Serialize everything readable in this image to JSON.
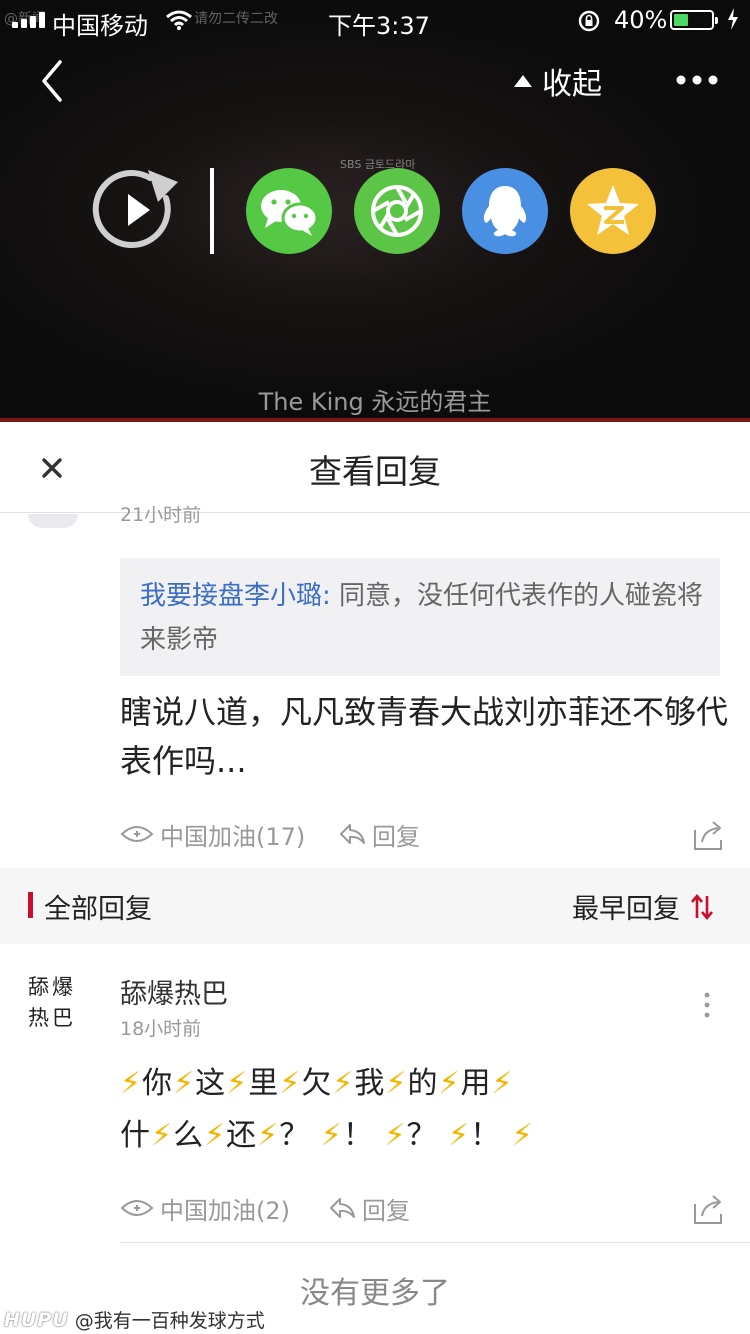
{
  "status_bar": {
    "carrier": "中国移动",
    "time": "下午3:37",
    "battery_percent": "40%",
    "battery_level": 0.4,
    "watermark_left": "@新闻",
    "watermark_right": "请勿二传二改"
  },
  "video": {
    "collapse_label": "收起",
    "subtitle": "The King 永远的君主",
    "logo_text": "SBS 금토드라마",
    "share_targets": [
      "wechat-icon",
      "moments-icon",
      "qq-icon",
      "qzone-icon"
    ]
  },
  "sheet": {
    "title": "查看回复"
  },
  "parent_comment": {
    "time": "21小时前",
    "quote_user": "我要接盘李小璐:",
    "quote_text": " 同意，没任何代表作的人碰瓷将来影帝",
    "text": "瞎说八道，凡凡致青春大战刘亦菲还不够代表作吗...",
    "like_label": "中国加油(17)",
    "reply_label": "回复"
  },
  "section": {
    "title": "全部回复",
    "sort_label": "最早回复"
  },
  "reply": {
    "avatar_text": "舔爆热巴",
    "user_name": "舔爆热巴",
    "time": "18小时前",
    "line1": "⚡你⚡这⚡里⚡欠⚡我⚡的⚡用⚡",
    "line2": "什⚡么⚡还⚡？ ⚡！ ⚡？ ⚡！ ⚡",
    "like_label": "中国加油(2)",
    "reply_label": "回复"
  },
  "footer": {
    "no_more": "没有更多了",
    "brand": "HUPU",
    "credit": "@我有一百种发球方式"
  },
  "colors": {
    "accent_red": "#c8102e",
    "link_blue": "#3b6fc6",
    "lightning": "#f5b400",
    "wechat_green": "#55c846",
    "qq_blue": "#4a90e2",
    "qzone_yellow": "#f4c23a"
  }
}
